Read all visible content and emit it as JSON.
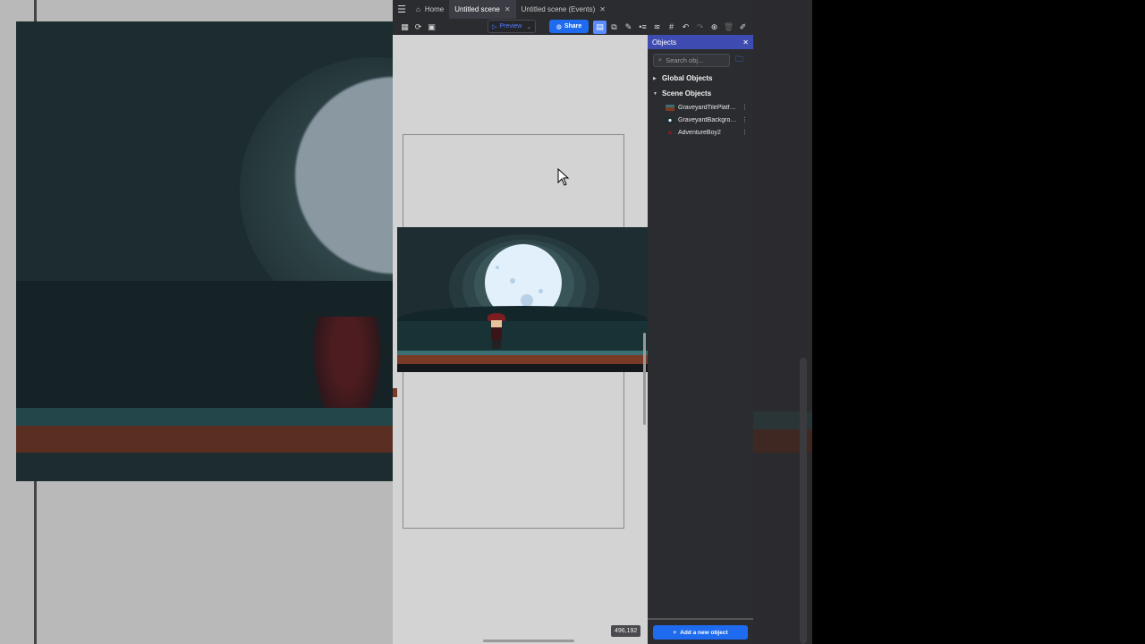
{
  "tabs": [
    {
      "label": "Home"
    },
    {
      "label": "Untitled scene"
    },
    {
      "label": "Untitled scene (Events)"
    }
  ],
  "toolbar": {
    "preview_label": "Preview",
    "share_label": "Share"
  },
  "canvas": {
    "coords": "496,192"
  },
  "objects_panel": {
    "title": "Objects",
    "search_placeholder": "Search obj...",
    "groups": [
      {
        "label": "Global Objects"
      },
      {
        "label": "Scene Objects"
      }
    ],
    "items": [
      {
        "name": "GraveyardTilePlatfor..."
      },
      {
        "name": "GraveyardBackground"
      },
      {
        "name": "AdventureBoy2"
      }
    ],
    "add_label": "Add a new object"
  },
  "colors": {
    "accent": "#1e6bef",
    "panel_header": "#3e4bb0",
    "panel_bg": "#2b2c30"
  }
}
